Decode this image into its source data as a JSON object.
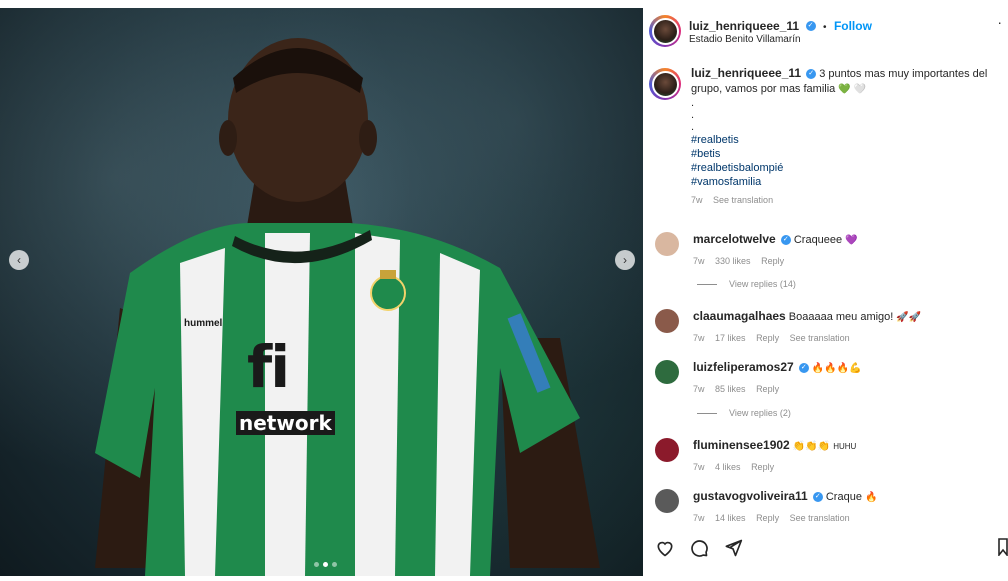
{
  "post": {
    "username": "luiz_henriqueee_11",
    "follow_label": "Follow",
    "separator": "•",
    "location": "Estadio Benito Villamarín",
    "more_label": "·",
    "caption_text": "3 puntos mas muy importantes del grupo, vamos por mas familia",
    "caption_emojis": "💚 🤍",
    "caption_dots": [
      ".",
      ".",
      "."
    ],
    "hashtags": [
      "#realbetis",
      "#betis",
      "#realbetisbalompié",
      "#vamosfamilia"
    ],
    "time": "7w",
    "see_translation": "See translation"
  },
  "photo": {
    "jersey_sponsor_main": "fi",
    "jersey_sponsor_sub": "network",
    "jersey_brand": "hummel"
  },
  "comments": [
    {
      "username": "marcelotwelve",
      "verified": true,
      "text": "Craqueee",
      "emoji": "💜",
      "time": "7w",
      "likes": "330 likes",
      "reply": "Reply",
      "translation": "",
      "avatar_color": "#d9b7a0",
      "view_replies": "View replies (14)"
    },
    {
      "username": "claaumagalhaes",
      "verified": false,
      "text": "Boaaaaa meu amigo!",
      "emoji": "🚀🚀",
      "time": "7w",
      "likes": "17 likes",
      "reply": "Reply",
      "translation": "See translation",
      "avatar_color": "#8a5a4a",
      "view_replies": ""
    },
    {
      "username": "luizfeliperamos27",
      "verified": true,
      "text": "",
      "emoji": "🔥🔥🔥💪",
      "time": "7w",
      "likes": "85 likes",
      "reply": "Reply",
      "translation": "",
      "avatar_color": "#2e6b3e",
      "view_replies": "View replies (2)"
    },
    {
      "username": "fluminensee1902",
      "verified": false,
      "text": "HUHU",
      "emoji": "👏👏👏",
      "time": "7w",
      "likes": "4 likes",
      "reply": "Reply",
      "translation": "",
      "avatar_color": "#8b1a2b",
      "view_replies": ""
    },
    {
      "username": "gustavogvoliveira11",
      "verified": true,
      "text": "Craque",
      "emoji": "🔥",
      "time": "7w",
      "likes": "14 likes",
      "reply": "Reply",
      "translation": "See translation",
      "avatar_color": "#5a5a5a",
      "view_replies": ""
    }
  ],
  "colors": {
    "link_blue": "#0095f6",
    "verified_blue": "#3897f0",
    "hashtag_navy": "#00376b",
    "meta_gray": "#8e8e8e",
    "jersey_green": "#1f8a4c"
  },
  "icons": {
    "like": "heart-icon",
    "comment": "comment-icon",
    "share": "paper-plane-icon",
    "save": "bookmark-icon",
    "prev": "chevron-left-icon",
    "next": "chevron-right-icon"
  }
}
